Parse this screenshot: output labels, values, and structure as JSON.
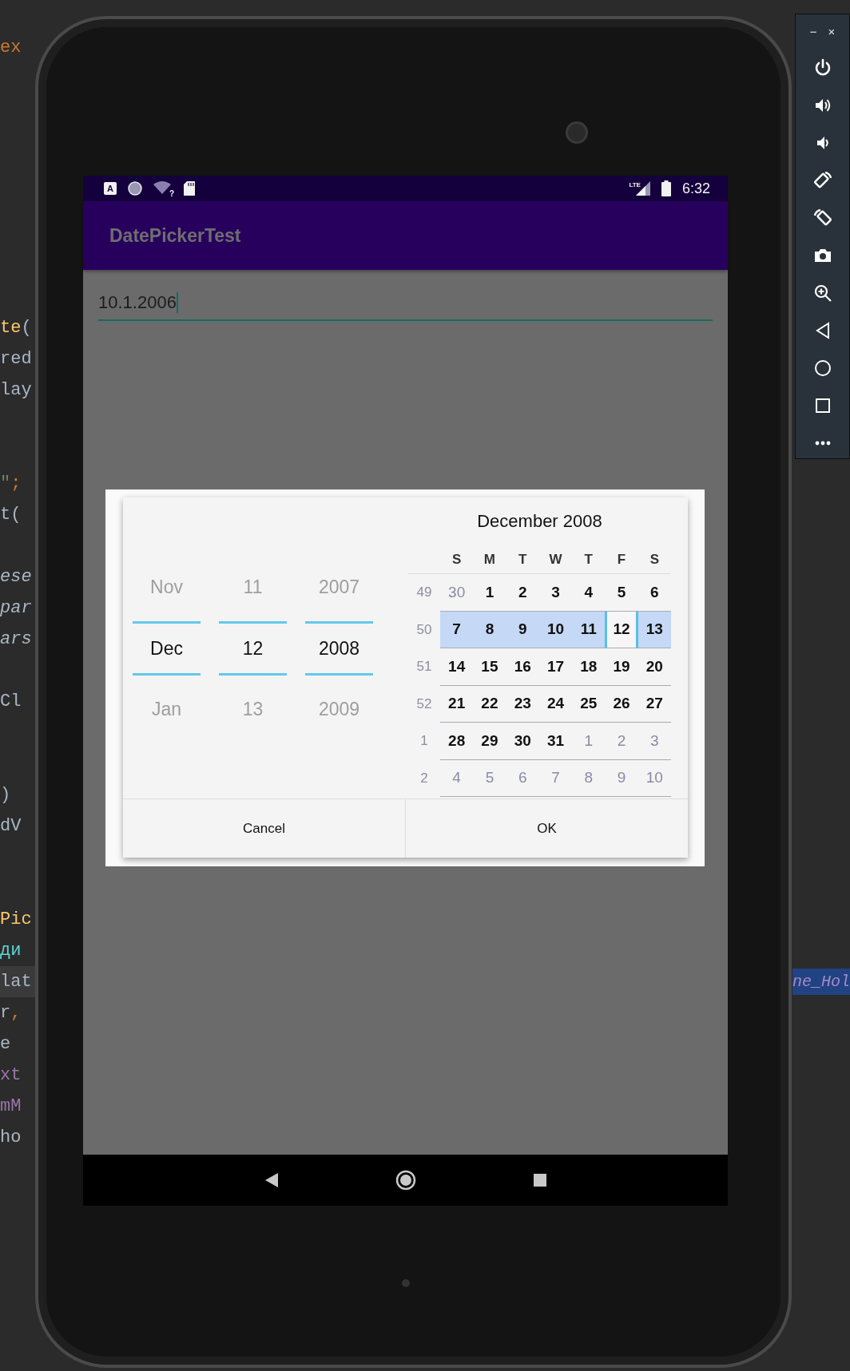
{
  "code_editor": {
    "lines": [
      {
        "kind": "code",
        "current": false,
        "tokens": [
          {
            "text": "ex",
            "kind": "keyword"
          }
        ]
      },
      {
        "kind": "blank"
      },
      {
        "kind": "blank"
      },
      {
        "kind": "blank"
      },
      {
        "kind": "blank"
      },
      {
        "kind": "blank"
      },
      {
        "kind": "blank"
      },
      {
        "kind": "blank"
      },
      {
        "kind": "blank"
      },
      {
        "kind": "code",
        "current": false,
        "tokens": [
          {
            "text": "te",
            "kind": "method"
          },
          {
            "text": "(",
            "kind": "plain"
          }
        ]
      },
      {
        "kind": "code",
        "current": false,
        "tokens": [
          {
            "text": "red",
            "kind": "plain"
          }
        ]
      },
      {
        "kind": "code",
        "current": false,
        "tokens": [
          {
            "text": "lay",
            "kind": "plain"
          }
        ]
      },
      {
        "kind": "blank"
      },
      {
        "kind": "blank"
      },
      {
        "kind": "code",
        "current": false,
        "tokens": [
          {
            "text": "\"",
            "kind": "string"
          },
          {
            "text": ";",
            "kind": "keyword"
          }
        ]
      },
      {
        "kind": "code",
        "current": false,
        "tokens": [
          {
            "text": "t(",
            "kind": "plain"
          }
        ]
      },
      {
        "kind": "blank"
      },
      {
        "kind": "code",
        "current": false,
        "tokens": [
          {
            "text": "ese",
            "kind": "italic"
          }
        ]
      },
      {
        "kind": "code",
        "current": false,
        "tokens": [
          {
            "text": "par",
            "kind": "italic"
          }
        ]
      },
      {
        "kind": "code",
        "current": false,
        "tokens": [
          {
            "text": "ars",
            "kind": "italic"
          }
        ]
      },
      {
        "kind": "blank"
      },
      {
        "kind": "code",
        "current": false,
        "tokens": [
          {
            "text": "Cl",
            "kind": "plain"
          }
        ]
      },
      {
        "kind": "blank"
      },
      {
        "kind": "blank"
      },
      {
        "kind": "code",
        "current": false,
        "tokens": [
          {
            "text": ")",
            "kind": "plain"
          }
        ]
      },
      {
        "kind": "code",
        "current": false,
        "tokens": [
          {
            "text": "dV",
            "kind": "plain"
          }
        ]
      },
      {
        "kind": "blank"
      },
      {
        "kind": "blank"
      },
      {
        "kind": "code",
        "current": false,
        "tokens": [
          {
            "text": "Pic",
            "kind": "method"
          }
        ]
      },
      {
        "kind": "code",
        "current": false,
        "tokens": [
          {
            "text": "ди",
            "kind": "cyrillic"
          }
        ]
      },
      {
        "kind": "code",
        "current": true,
        "tokens": [
          {
            "text": "lat",
            "kind": "plain"
          }
        ],
        "selected_text": "ne_Hol"
      },
      {
        "kind": "code",
        "current": false,
        "tokens": [
          {
            "text": "r",
            "kind": "plain"
          },
          {
            "text": ",",
            "kind": "keyword"
          }
        ]
      },
      {
        "kind": "code",
        "current": false,
        "tokens": [
          {
            "text": "e",
            "kind": "plain"
          }
        ]
      },
      {
        "kind": "code",
        "current": false,
        "tokens": [
          {
            "text": "xt",
            "kind": "field"
          }
        ]
      },
      {
        "kind": "code",
        "current": false,
        "tokens": [
          {
            "text": "mM",
            "kind": "field"
          }
        ]
      },
      {
        "kind": "code",
        "current": false,
        "tokens": [
          {
            "text": "ho",
            "kind": "plain"
          }
        ]
      }
    ]
  },
  "device": {
    "status_bar": {
      "notification_letter": "A",
      "wifi_mark": "?",
      "network": "LTE",
      "time": "6:32"
    },
    "app_bar": {
      "title": "DatePickerTest"
    },
    "date_field": {
      "value": "10.1.2006"
    },
    "dialog": {
      "spinners": [
        {
          "previous": "Nov",
          "current": "Dec",
          "next": "Jan"
        },
        {
          "previous": "11",
          "current": "12",
          "next": "13"
        },
        {
          "previous": "2007",
          "current": "2008",
          "next": "2009"
        }
      ],
      "calendar": {
        "title": "December 2008",
        "weekdays": [
          "S",
          "M",
          "T",
          "W",
          "T",
          "F",
          "S"
        ],
        "weeks": [
          {
            "number": "49",
            "selected": false,
            "days": [
              {
                "text": "30",
                "in_month": false,
                "selected": false
              },
              {
                "text": "1",
                "in_month": true,
                "selected": false
              },
              {
                "text": "2",
                "in_month": true,
                "selected": false
              },
              {
                "text": "3",
                "in_month": true,
                "selected": false
              },
              {
                "text": "4",
                "in_month": true,
                "selected": false
              },
              {
                "text": "5",
                "in_month": true,
                "selected": false
              },
              {
                "text": "6",
                "in_month": true,
                "selected": false
              }
            ]
          },
          {
            "number": "50",
            "selected": true,
            "days": [
              {
                "text": "7",
                "in_month": true,
                "selected": false
              },
              {
                "text": "8",
                "in_month": true,
                "selected": false
              },
              {
                "text": "9",
                "in_month": true,
                "selected": false
              },
              {
                "text": "10",
                "in_month": true,
                "selected": false
              },
              {
                "text": "11",
                "in_month": true,
                "selected": false
              },
              {
                "text": "12",
                "in_month": true,
                "selected": true
              },
              {
                "text": "13",
                "in_month": true,
                "selected": false
              }
            ]
          },
          {
            "number": "51",
            "selected": false,
            "days": [
              {
                "text": "14",
                "in_month": true,
                "selected": false
              },
              {
                "text": "15",
                "in_month": true,
                "selected": false
              },
              {
                "text": "16",
                "in_month": true,
                "selected": false
              },
              {
                "text": "17",
                "in_month": true,
                "selected": false
              },
              {
                "text": "18",
                "in_month": true,
                "selected": false
              },
              {
                "text": "19",
                "in_month": true,
                "selected": false
              },
              {
                "text": "20",
                "in_month": true,
                "selected": false
              }
            ]
          },
          {
            "number": "52",
            "selected": false,
            "days": [
              {
                "text": "21",
                "in_month": true,
                "selected": false
              },
              {
                "text": "22",
                "in_month": true,
                "selected": false
              },
              {
                "text": "23",
                "in_month": true,
                "selected": false
              },
              {
                "text": "24",
                "in_month": true,
                "selected": false
              },
              {
                "text": "25",
                "in_month": true,
                "selected": false
              },
              {
                "text": "26",
                "in_month": true,
                "selected": false
              },
              {
                "text": "27",
                "in_month": true,
                "selected": false
              }
            ]
          },
          {
            "number": "1",
            "selected": false,
            "days": [
              {
                "text": "28",
                "in_month": true,
                "selected": false
              },
              {
                "text": "29",
                "in_month": true,
                "selected": false
              },
              {
                "text": "30",
                "in_month": true,
                "selected": false
              },
              {
                "text": "31",
                "in_month": true,
                "selected": false
              },
              {
                "text": "1",
                "in_month": false,
                "selected": false
              },
              {
                "text": "2",
                "in_month": false,
                "selected": false
              },
              {
                "text": "3",
                "in_month": false,
                "selected": false
              }
            ]
          },
          {
            "number": "2",
            "selected": false,
            "days": [
              {
                "text": "4",
                "in_month": false,
                "selected": false
              },
              {
                "text": "5",
                "in_month": false,
                "selected": false
              },
              {
                "text": "6",
                "in_month": false,
                "selected": false
              },
              {
                "text": "7",
                "in_month": false,
                "selected": false
              },
              {
                "text": "8",
                "in_month": false,
                "selected": false
              },
              {
                "text": "9",
                "in_month": false,
                "selected": false
              },
              {
                "text": "10",
                "in_month": false,
                "selected": false
              }
            ]
          }
        ]
      },
      "buttons": [
        {
          "label": "Cancel"
        },
        {
          "label": "OK"
        }
      ]
    }
  },
  "emulator_toolbar": {
    "minimize": "−",
    "close": "×"
  }
}
